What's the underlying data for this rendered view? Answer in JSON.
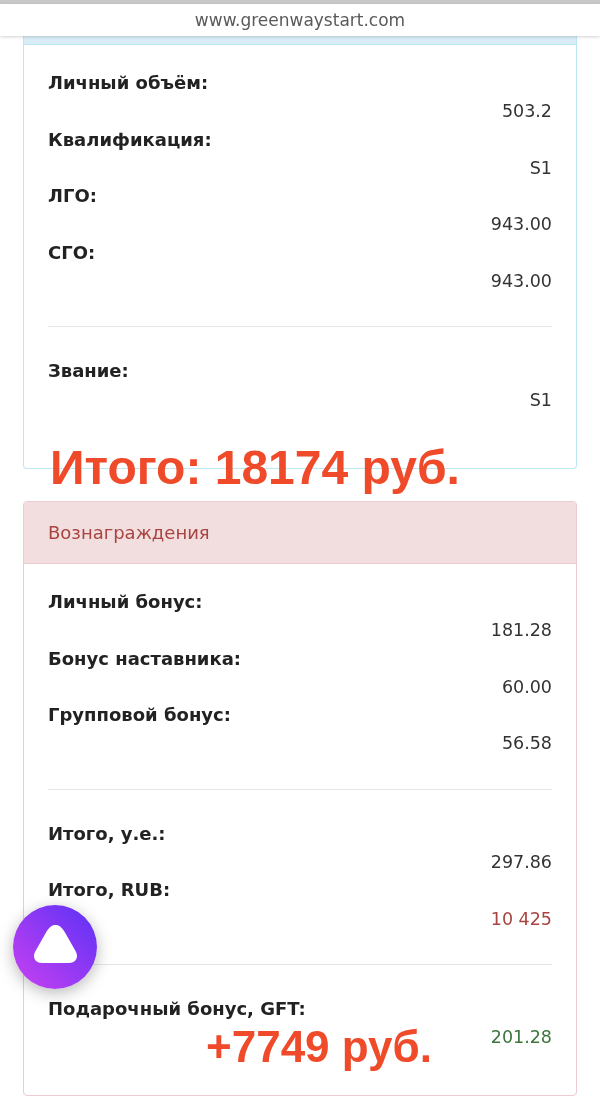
{
  "browser": {
    "url": "www.greenwaystart.com"
  },
  "panels": [
    {
      "kind": "info",
      "sections": [
        {
          "rows": [
            {
              "label": "Личный объём:",
              "value": "503.2",
              "kind": "plain"
            },
            {
              "label": "Квалификация:",
              "value": "S1",
              "kind": "plain"
            },
            {
              "label": "ЛГО:",
              "value": "943.00",
              "kind": "plain"
            },
            {
              "label": "СГО:",
              "value": "943.00",
              "kind": "plain"
            }
          ]
        },
        {
          "rows": [
            {
              "label": "Звание:",
              "value": "S1",
              "kind": "plain"
            }
          ]
        }
      ],
      "annotation": "Итого: 18174 руб."
    },
    {
      "kind": "danger",
      "title": "Вознаграждения",
      "sections": [
        {
          "rows": [
            {
              "label": "Личный бонус:",
              "value": "181.28",
              "kind": "plain"
            },
            {
              "label": "Бонус наставника:",
              "value": "60.00",
              "kind": "plain"
            },
            {
              "label": "Групповой бонус:",
              "value": "56.58",
              "kind": "plain"
            }
          ]
        },
        {
          "rows": [
            {
              "label": "Итого, у.е.:",
              "value": "297.86",
              "kind": "plain"
            },
            {
              "label": "Итого, RUB:",
              "value": "10 425",
              "kind": "danger"
            }
          ]
        },
        {
          "rows": [
            {
              "label": "Подарочный бонус, GFT:",
              "value": "201.28",
              "kind": "success"
            }
          ],
          "annotation": "+7749 руб."
        }
      ]
    }
  ]
}
